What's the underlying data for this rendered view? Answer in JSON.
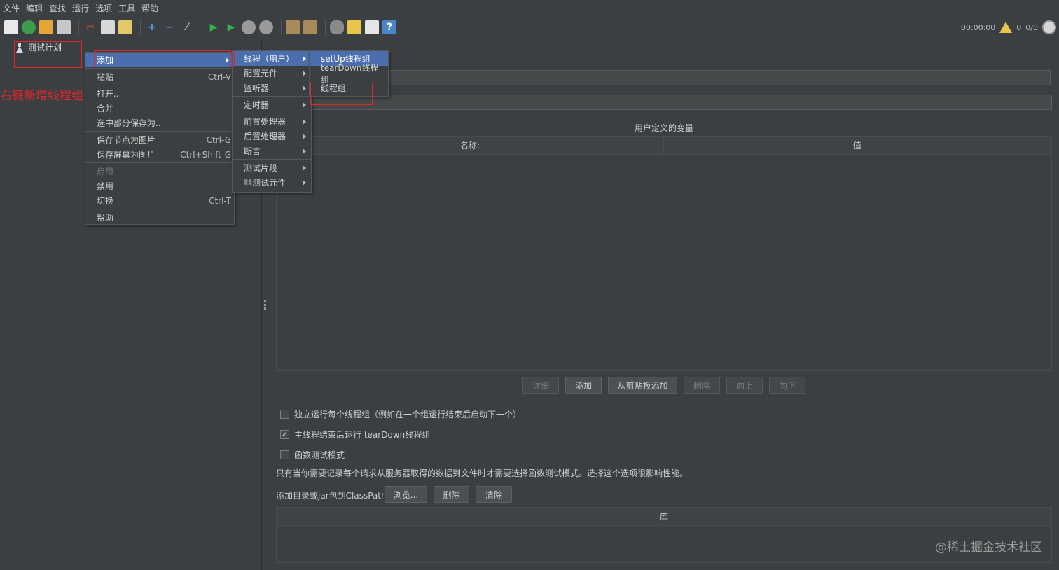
{
  "menubar": [
    "文件",
    "编辑",
    "查找",
    "运行",
    "选项",
    "工具",
    "帮助"
  ],
  "toolbar": {
    "timer": "00:00:00",
    "warn_count": "0",
    "thread_ratio": "0/0",
    "icons": [
      "new-icon",
      "template-icon",
      "open-icon",
      "save-icon",
      "cut-icon",
      "copy-icon",
      "paste-icon",
      "expand-icon",
      "collapse-icon",
      "toggle-icon",
      "start-icon",
      "start-no-pause-icon",
      "stop-icon",
      "shutdown-icon",
      "clear-icon",
      "clear-all-icon",
      "search-icon",
      "reset-search-icon",
      "function-helper-icon",
      "help-icon"
    ]
  },
  "tree": {
    "root_label": "测试计划"
  },
  "annotation": {
    "label": "右键新增线程组",
    "color": "#e0262a"
  },
  "context_menu": {
    "items": [
      {
        "label": "添加",
        "submenu": true
      },
      {
        "label": "粘贴",
        "shortcut": "Ctrl-V"
      },
      {
        "label": "打开..."
      },
      {
        "label": "合并"
      },
      {
        "label": "选中部分保存为..."
      },
      {
        "label": "保存节点为图片",
        "shortcut": "Ctrl-G"
      },
      {
        "label": "保存屏幕为图片",
        "shortcut": "Ctrl+Shift-G"
      },
      {
        "label": "启用",
        "disabled": true
      },
      {
        "label": "禁用"
      },
      {
        "label": "切换",
        "shortcut": "Ctrl-T"
      },
      {
        "label": "帮助"
      }
    ]
  },
  "add_submenu": {
    "items": [
      "线程（用户）",
      "配置元件",
      "监听器",
      "定时器",
      "前置处理器",
      "后置处理器",
      "断言",
      "测试片段",
      "非测试元件"
    ]
  },
  "thread_submenu": {
    "items": [
      "setUp线程组",
      "tearDown线程组",
      "线程组"
    ]
  },
  "main": {
    "section_title": "用户定义的变量",
    "col_name": "名称:",
    "col_value": "值",
    "buttons": {
      "detail": "详细",
      "add": "添加",
      "add_clipboard": "从剪贴板添加",
      "delete": "删除",
      "up": "向上",
      "down": "向下"
    },
    "checkbox_independent": "独立运行每个线程组（例如在一个组运行结束后启动下一个）",
    "checkbox_teardown": "主线程结束后运行 tearDown线程组",
    "checkbox_teardown_checked": true,
    "checkbox_functional": "函数测试模式",
    "info": "只有当你需要记录每个请求从服务器取得的数据到文件时才需要选择函数测试模式。选择这个选项很影响性能。",
    "classpath_label": "添加目录或jar包到ClassPath",
    "browse": "浏览...",
    "cp_delete": "删除",
    "cp_clear": "清除",
    "lib_header": "库"
  },
  "watermark": "@稀土掘金技术社区"
}
